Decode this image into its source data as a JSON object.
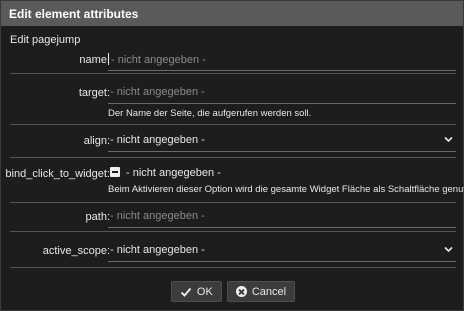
{
  "dialog": {
    "title": "Edit element attributes",
    "subtitle": "Edit pagejump"
  },
  "fields": {
    "name": {
      "label": "name:",
      "placeholder": "- nicht angegeben -"
    },
    "target": {
      "label": "target:",
      "placeholder": "- nicht angegeben -",
      "help": "Der Name der Seite, die aufgerufen werden soll."
    },
    "align": {
      "label": "align:",
      "value": "- nicht angegeben -"
    },
    "bind_click_to_widget": {
      "label": "bind_click_to_widget:",
      "value": "- nicht angegeben -",
      "help": "Beim Aktivieren dieser Option wird die gesamte Widget Fläche als Schaltfläche genutzt"
    },
    "path": {
      "label": "path:",
      "placeholder": "- nicht angegeben -"
    },
    "active_scope": {
      "label": "active_scope:",
      "value": "- nicht angegeben -"
    }
  },
  "buttons": {
    "ok_label": "OK",
    "cancel_label": "Cancel"
  },
  "icons": {
    "check": "check-icon",
    "cancel": "cancel-icon",
    "chevron": "chevron-down-icon",
    "checkbox": "indeterminate-checkbox"
  }
}
